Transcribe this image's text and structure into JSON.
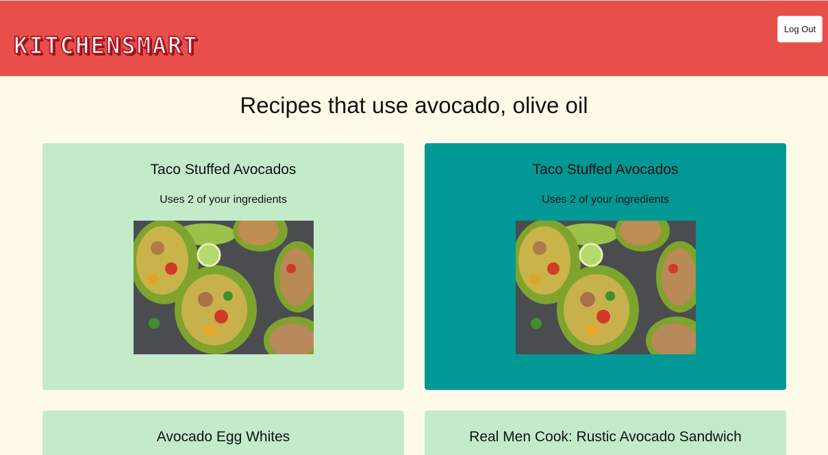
{
  "header": {
    "logo": "KITCHENSMART",
    "logout_label": "Log Out"
  },
  "page": {
    "title": "Recipes that use avocado, olive oil"
  },
  "recipes": [
    {
      "title": "Taco Stuffed Avocados",
      "uses": "Uses 2 of your ingredients",
      "image": "taco-stuffed-avocados-photo"
    },
    {
      "title": "Taco Stuffed Avocados",
      "uses": "Uses 2 of your ingredients",
      "image": "taco-stuffed-avocados-photo"
    },
    {
      "title": "Avocado Egg Whites"
    },
    {
      "title": "Real Men Cook: Rustic Avocado Sandwich"
    }
  ],
  "colors": {
    "header": "#e84f4a",
    "background": "#fffbe8",
    "card": "#c3ebca",
    "card_active": "#019895"
  }
}
